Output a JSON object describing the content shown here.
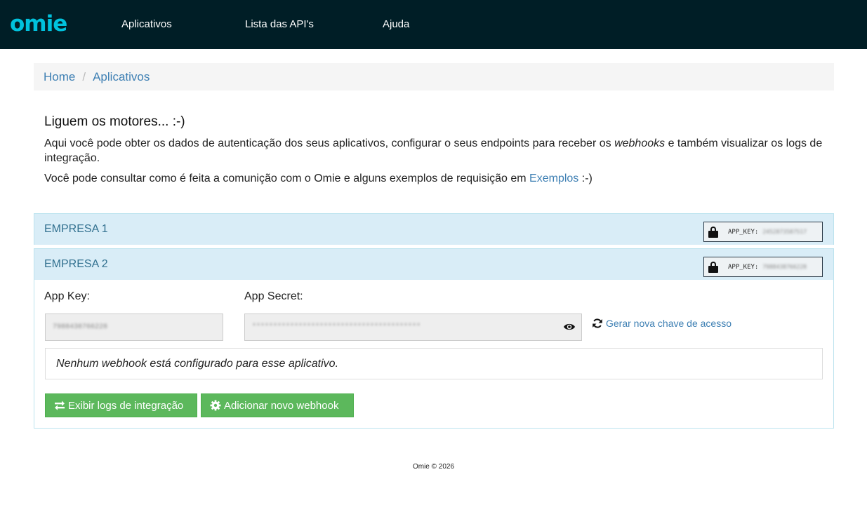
{
  "navbar": {
    "logo": "omie",
    "links": [
      "Aplicativos",
      "Lista das API's",
      "Ajuda"
    ]
  },
  "breadcrumb": {
    "items": [
      "Home",
      "Aplicativos"
    ],
    "separator": "/"
  },
  "intro": {
    "title": "Liguem os motores... :-)",
    "p1_before": "Aqui você pode obter os dados de autenticação dos seus aplicativos, configurar o seus endpoints para receber os ",
    "p1_em": "webhooks",
    "p1_after": " e também visualizar os logs de integração.",
    "p2_before": "Você pode consultar como é feita a comunição com o Omie e alguns exemplos de requisição em ",
    "p2_link": "Exemplos",
    "p2_after": " :-)"
  },
  "companies": [
    {
      "name": "EMPRESA 1",
      "key_label": "APP_KEY:",
      "key_value": "2452873587517"
    },
    {
      "name": "EMPRESA 2",
      "key_label": "APP_KEY:",
      "key_value": "7988438766228"
    }
  ],
  "details": {
    "app_key_label": "App Key:",
    "app_key_value": "7988438766228",
    "app_secret_label": "App Secret:",
    "app_secret_value": "****************************************",
    "regen_label": "Gerar nova chave de acesso",
    "webhook_empty": "Nenhum webhook está configurado para esse aplicativo.",
    "btn_logs": "Exibir logs de integração",
    "btn_webhook": "Adicionar novo webhook"
  },
  "footer": "Omie © 2026",
  "colors": {
    "navbar_bg": "#001e26",
    "logo": "#00c2dd",
    "link": "#3d7fb3",
    "panel_heading_bg": "#d9edf7",
    "button_green": "#5cb85c"
  },
  "icons": [
    "lock-icon",
    "eye-icon",
    "refresh-icon",
    "exchange-icon",
    "gear-icon"
  ]
}
